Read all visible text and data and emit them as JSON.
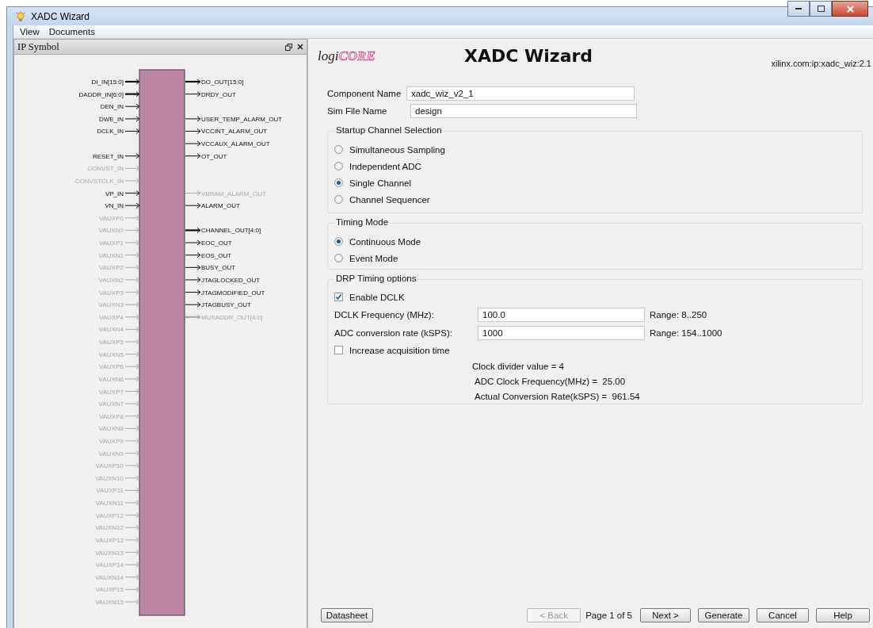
{
  "window": {
    "title": "XADC Wizard"
  },
  "menu": [
    {
      "label": "View"
    },
    {
      "label": "Documents"
    }
  ],
  "ip_symbol": {
    "title": "IP Symbol",
    "left_pin_groups": [
      [
        {
          "name": "DI_IN[15:0]",
          "bus": true,
          "enabled": true
        },
        {
          "name": "DADDR_IN[6:0]",
          "bus": true,
          "enabled": true
        },
        {
          "name": "DEN_IN",
          "bus": false,
          "enabled": true
        },
        {
          "name": "DWE_IN",
          "bus": false,
          "enabled": true
        },
        {
          "name": "DCLK_IN",
          "bus": false,
          "enabled": true
        }
      ],
      [
        {
          "name": "RESET_IN",
          "bus": false,
          "enabled": true
        },
        {
          "name": "CONVST_IN",
          "bus": false,
          "enabled": false
        },
        {
          "name": "CONVSTCLK_IN",
          "bus": false,
          "enabled": false
        },
        {
          "name": "VP_IN",
          "bus": false,
          "enabled": true
        },
        {
          "name": "VN_IN",
          "bus": false,
          "enabled": true
        },
        {
          "name": "VAUXP0",
          "bus": false,
          "enabled": false
        },
        {
          "name": "VAUXN0",
          "bus": false,
          "enabled": false
        },
        {
          "name": "VAUXP1",
          "bus": false,
          "enabled": false
        },
        {
          "name": "VAUXN1",
          "bus": false,
          "enabled": false
        },
        {
          "name": "VAUXP2",
          "bus": false,
          "enabled": false
        },
        {
          "name": "VAUXN2",
          "bus": false,
          "enabled": false
        },
        {
          "name": "VAUXP3",
          "bus": false,
          "enabled": false
        },
        {
          "name": "VAUXN3",
          "bus": false,
          "enabled": false
        },
        {
          "name": "VAUXP4",
          "bus": false,
          "enabled": false
        },
        {
          "name": "VAUXN4",
          "bus": false,
          "enabled": false
        },
        {
          "name": "VAUXP5",
          "bus": false,
          "enabled": false
        },
        {
          "name": "VAUXN5",
          "bus": false,
          "enabled": false
        },
        {
          "name": "VAUXP6",
          "bus": false,
          "enabled": false
        },
        {
          "name": "VAUXN6",
          "bus": false,
          "enabled": false
        },
        {
          "name": "VAUXP7",
          "bus": false,
          "enabled": false
        },
        {
          "name": "VAUXN7",
          "bus": false,
          "enabled": false
        },
        {
          "name": "VAUXP8",
          "bus": false,
          "enabled": false
        },
        {
          "name": "VAUXN8",
          "bus": false,
          "enabled": false
        },
        {
          "name": "VAUXP9",
          "bus": false,
          "enabled": false
        },
        {
          "name": "VAUXN9",
          "bus": false,
          "enabled": false
        },
        {
          "name": "VAUXP10",
          "bus": false,
          "enabled": false
        },
        {
          "name": "VAUXN10",
          "bus": false,
          "enabled": false
        },
        {
          "name": "VAUXP11",
          "bus": false,
          "enabled": false
        },
        {
          "name": "VAUXN11",
          "bus": false,
          "enabled": false
        },
        {
          "name": "VAUXP12",
          "bus": false,
          "enabled": false
        },
        {
          "name": "VAUXN12",
          "bus": false,
          "enabled": false
        },
        {
          "name": "VAUXP13",
          "bus": false,
          "enabled": false
        },
        {
          "name": "VAUXN13",
          "bus": false,
          "enabled": false
        },
        {
          "name": "VAUXP14",
          "bus": false,
          "enabled": false
        },
        {
          "name": "VAUXN14",
          "bus": false,
          "enabled": false
        },
        {
          "name": "VAUXP15",
          "bus": false,
          "enabled": false
        },
        {
          "name": "VAUXN15",
          "bus": false,
          "enabled": false
        }
      ]
    ],
    "right_pin_groups": [
      [
        {
          "name": "DO_OUT[15:0]",
          "bus": true,
          "enabled": true
        },
        {
          "name": "DRDY_OUT",
          "bus": false,
          "enabled": true
        }
      ],
      [
        {
          "name": "USER_TEMP_ALARM_OUT",
          "bus": false,
          "enabled": true
        },
        {
          "name": "VCCINT_ALARM_OUT",
          "bus": false,
          "enabled": true
        },
        {
          "name": "VCCAUX_ALARM_OUT",
          "bus": false,
          "enabled": true
        },
        {
          "name": "OT_OUT",
          "bus": false,
          "enabled": true
        }
      ],
      [
        {
          "name": "VBRAM_ALARM_OUT",
          "bus": false,
          "enabled": false
        },
        {
          "name": "ALARM_OUT",
          "bus": false,
          "enabled": true
        }
      ],
      [
        {
          "name": "CHANNEL_OUT[4:0]",
          "bus": true,
          "enabled": true
        },
        {
          "name": "EOC_OUT",
          "bus": false,
          "enabled": true
        },
        {
          "name": "EOS_OUT",
          "bus": false,
          "enabled": true
        },
        {
          "name": "BUSY_OUT",
          "bus": false,
          "enabled": true
        },
        {
          "name": "JTAGLOCKED_OUT",
          "bus": false,
          "enabled": true
        },
        {
          "name": "JTAGMODIFIED_OUT",
          "bus": false,
          "enabled": true
        },
        {
          "name": "JTAGBUSY_OUT",
          "bus": false,
          "enabled": true
        },
        {
          "name": "MUXADDR_OUT[4:0]",
          "bus": true,
          "enabled": false
        }
      ]
    ]
  },
  "wizard": {
    "logo": [
      "logi",
      "CORE"
    ],
    "title": "XADC Wizard",
    "version": "xilinx.com:ip:xadc_wiz:2.1",
    "component_name": {
      "label": "Component Name",
      "value": "xadc_wiz_v2_1"
    },
    "sim_file_name": {
      "label": "Sim File Name",
      "value": "design"
    },
    "startup_channel": {
      "title": "Startup Channel Selection",
      "options": [
        {
          "label": "Simultaneous Sampling",
          "selected": false
        },
        {
          "label": "Independent ADC",
          "selected": false
        },
        {
          "label": "Single Channel",
          "selected": true
        },
        {
          "label": "Channel Sequencer",
          "selected": false
        }
      ]
    },
    "timing_mode": {
      "title": "Timing Mode",
      "options": [
        {
          "label": "Continuous Mode",
          "selected": true
        },
        {
          "label": "Event Mode",
          "selected": false
        }
      ]
    },
    "drp_timing": {
      "title": "DRP Timing options",
      "enable_dclk": {
        "label": "Enable DCLK",
        "checked": true
      },
      "fields": [
        {
          "label": "DCLK Frequency (MHz):",
          "value": "100.0",
          "range": "Range: 8..250"
        },
        {
          "label": "ADC conversion rate (kSPS):",
          "value": "1000",
          "range": "Range: 154..1000"
        }
      ],
      "increase_acquisition": {
        "label": "Increase acquisition time",
        "checked": false
      },
      "results": [
        "Clock divider value = 4",
        "ADC Clock Frequency(MHz) =  25.00",
        "Actual Conversion Rate(kSPS) =  961.54"
      ]
    }
  },
  "footer": {
    "datasheet": "Datasheet",
    "back": {
      "label": "< Back",
      "disabled": true
    },
    "page": "Page 1 of 5",
    "buttons": [
      {
        "label": "Next >"
      },
      {
        "label": "Generate"
      },
      {
        "label": "Cancel"
      },
      {
        "label": "Help"
      }
    ]
  }
}
